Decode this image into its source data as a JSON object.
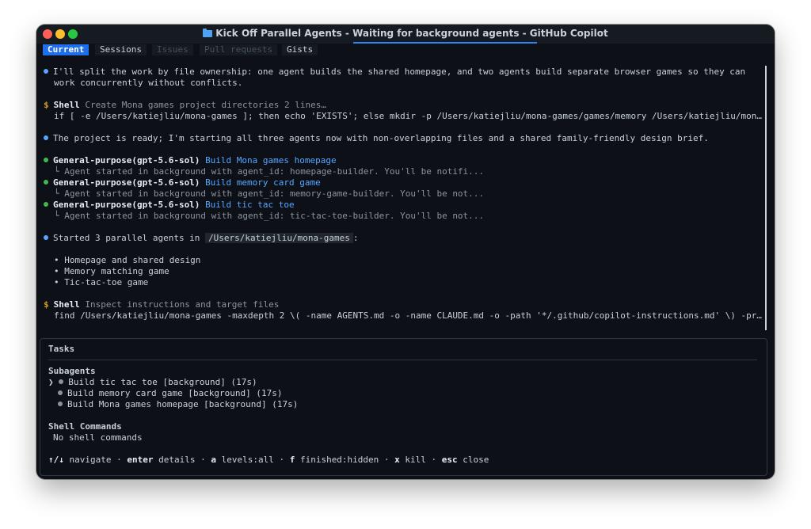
{
  "window": {
    "title": "Kick Off Parallel Agents - Waiting for background agents - GitHub Copilot"
  },
  "tabs": [
    {
      "label": "Current"
    },
    {
      "label": "Sessions"
    },
    {
      "label": "Issues"
    },
    {
      "label": "Pull requests"
    },
    {
      "label": "Gists"
    }
  ],
  "transcript": {
    "intro_1": "I'll split the work by file ownership: one agent builds the shared homepage, and two agents build separate browser games so they can",
    "intro_2": "work concurrently without conflicts.",
    "shell1": {
      "label": "Shell",
      "desc": "Create Mona games project directories 2 lines…",
      "cmd": "if [ -e /Users/katiejliu/mona-games ]; then echo 'EXISTS'; else mkdir -p /Users/katiejliu/mona-games/games/memory /Users/katiejliu/mon…"
    },
    "ready": "The project is ready; I'm starting all three agents now with non-overlapping files and a shared family-friendly design brief.",
    "agents": [
      {
        "name": "General-purpose(gpt-5.6-sol)",
        "task": "Build Mona games homepage",
        "detail": "└ Agent started in background with agent_id: homepage-builder. You'll be notifi..."
      },
      {
        "name": "General-purpose(gpt-5.6-sol)",
        "task": "Build memory card game",
        "detail": "└ Agent started in background with agent_id: memory-game-builder. You'll be not..."
      },
      {
        "name": "General-purpose(gpt-5.6-sol)",
        "task": "Build tic tac toe",
        "detail": "└ Agent started in background with agent_id: tic-tac-toe-builder. You'll be not..."
      }
    ],
    "started_prefix": "Started 3 parallel agents in",
    "started_path": "/Users/katiejliu/mona-games",
    "started_suffix": ":",
    "bullets": [
      "• Homepage and shared design",
      "• Memory matching game",
      "• Tic-tac-toe game"
    ],
    "shell2": {
      "label": "Shell",
      "desc": "Inspect instructions and target files",
      "cmd": "find /Users/katiejliu/mona-games -maxdepth 2 \\( -name AGENTS.md -o -name CLAUDE.md -o -path '*/.github/copilot-instructions.md' \\) -pr…"
    }
  },
  "tasks": {
    "title": "Tasks",
    "subagents_header": "Subagents",
    "subagents": [
      {
        "label": "Build tic tac toe [background] (17s)",
        "selected": true
      },
      {
        "label": "Build memory card game [background] (17s)",
        "selected": false
      },
      {
        "label": "Build Mona games homepage [background] (17s)",
        "selected": false
      }
    ],
    "selector": "❯",
    "shell_header": "Shell Commands",
    "shell_empty": "No shell commands",
    "hints": [
      {
        "key": "↑/↓",
        "text": "navigate"
      },
      {
        "key": "enter",
        "text": "details"
      },
      {
        "key": "a",
        "text": "levels:all"
      },
      {
        "key": "f",
        "text": "finished:hidden"
      },
      {
        "key": "x",
        "text": "kill"
      },
      {
        "key": "esc",
        "text": "close"
      }
    ],
    "hint_sep": "·"
  },
  "colors": {
    "background": "#0d1117",
    "accent": "#58a6ff",
    "success": "#3fb950",
    "shell": "#d29922"
  }
}
